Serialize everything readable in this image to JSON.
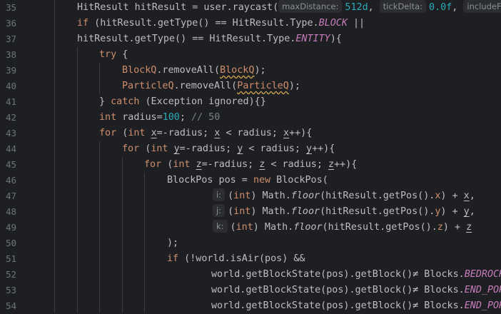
{
  "line_numbers": [
    "35",
    "36",
    "37",
    "38",
    "39",
    "40",
    "41",
    "42",
    "43",
    "44",
    "45",
    "46",
    "47",
    "48",
    "49",
    "50",
    "51",
    "52",
    "53",
    "54"
  ],
  "code": {
    "l35": {
      "text1": "HitResult hitResult = user.raycast(",
      "hint1": "maxDistance:",
      "val1": "512d",
      "sep1": ",",
      "hint2": "tickDelta:",
      "val2": "0.0f",
      "sep2": ",",
      "hint3": "includeFluid"
    },
    "l36": {
      "kw": "if",
      "text": " (hitResult.getType() == HitResult.Type.",
      "const": "BLOCK",
      "tail": " ||"
    },
    "l37": {
      "text": "hitResult.getType() == HitResult.Type.",
      "const": "ENTITY",
      "tail": "){"
    },
    "l38": {
      "kw": "try",
      "tail": " {"
    },
    "l39": {
      "cls": "BlockQ",
      "mid": ".removeAll(",
      "arg": "BlockQ",
      "tail": ");"
    },
    "l40": {
      "cls": "ParticleQ",
      "mid": ".removeAll(",
      "arg": "ParticleQ",
      "tail": ");"
    },
    "l41": {
      "pre": "} ",
      "kw": "catch",
      "tail": " (Exception ignored){}"
    },
    "l42": {
      "kw": "int",
      "mid": " radius=",
      "num": "100",
      "semi": "; ",
      "comment": "// 50"
    },
    "l43": {
      "kw1": "for",
      "p1": " (",
      "kw2": "int",
      "sp": " ",
      "v1": "x",
      "p2": "=-radius; ",
      "v2": "x",
      "p3": " < radius; ",
      "v3": "x",
      "p4": "++){"
    },
    "l44": {
      "kw1": "for",
      "p1": " (",
      "kw2": "int",
      "sp": " ",
      "v1": "y",
      "p2": "=-radius; ",
      "v2": "y",
      "p3": " < radius; ",
      "v3": "y",
      "p4": "++){"
    },
    "l45": {
      "kw1": "for",
      "p1": " (",
      "kw2": "int",
      "sp": " ",
      "v1": "z",
      "p2": "=-radius; ",
      "v2": "z",
      "p3": " < radius; ",
      "v3": "z",
      "p4": "++){"
    },
    "l46": {
      "pre": "BlockPos pos = ",
      "kw": "new",
      "tail": " BlockPos("
    },
    "l47": {
      "hint": "i:",
      "p1": "(",
      "kw": "int",
      "p2": ") Math.",
      "fn": "floor",
      "p3": "(hitResult.getPos().",
      "f": "x",
      "p4": ") + ",
      "v": "x",
      "p5": ","
    },
    "l48": {
      "hint": "j:",
      "p1": "(",
      "kw": "int",
      "p2": ") Math.",
      "fn": "floor",
      "p3": "(hitResult.getPos().",
      "f": "y",
      "p4": ") + ",
      "v": "y",
      "p5": ","
    },
    "l49": {
      "hint": "k:",
      "p1": "(",
      "kw": "int",
      "p2": ") Math.",
      "fn": "floor",
      "p3": "(hitResult.getPos().",
      "f": "z",
      "p4": ") + ",
      "v": "z",
      "p5": ""
    },
    "l50": {
      "text": ");"
    },
    "l51": {
      "kw": "if",
      "tail": " (!world.isAir(pos) &&"
    },
    "l52": {
      "text": "world.getBlockState(pos).getBlock()≠ Blocks.",
      "const": "BEDROCK"
    },
    "l53": {
      "text": "world.getBlockState(pos).getBlock()≠ Blocks.",
      "const": "END_PORT"
    },
    "l54": {
      "text": "world.getBlockState(pos).getBlock()≠ Blocks.",
      "const": "END_POR"
    }
  },
  "colors": {
    "background": "#1e1f22",
    "keyword": "#cf8e6d",
    "number": "#2aacb8",
    "static_constant": "#c77dbb",
    "comment": "#7a7e85",
    "line_number": "#6f737a"
  }
}
